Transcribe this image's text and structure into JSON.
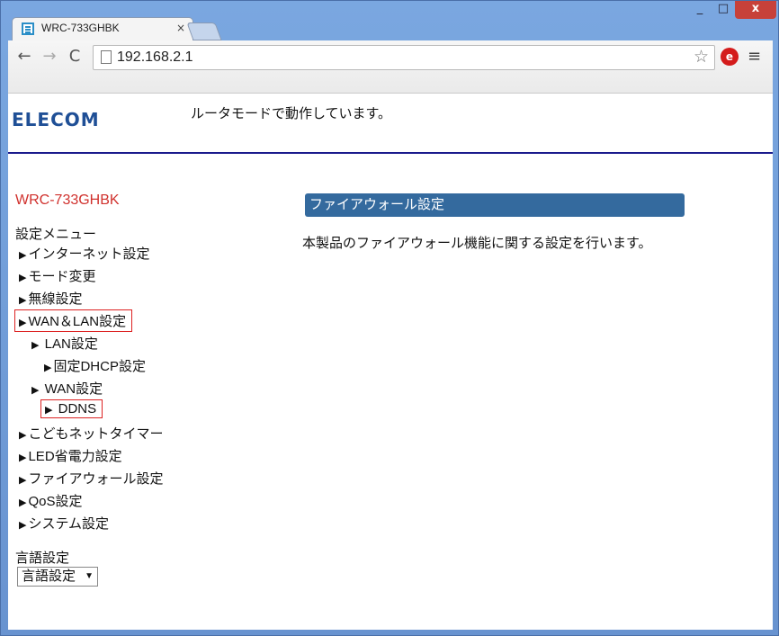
{
  "browser": {
    "tab_title": "WRC-733GHBK",
    "tab_close": "×",
    "url": "192.168.2.1",
    "window_min": "_",
    "window_max": "□",
    "window_close": "x",
    "nav_back": "←",
    "nav_forward": "→",
    "nav_reload": "C",
    "star_icon": "☆",
    "extension_icon": "e",
    "menu_icon": "≡"
  },
  "header": {
    "logo": "ELECOM",
    "mode_status": "ルータモードで動作しています。"
  },
  "sidebar": {
    "device_name": "WRC-733GHBK",
    "menu_heading": "設定メニュー",
    "items": [
      {
        "label": "インターネット設定"
      },
      {
        "label": "モード変更"
      },
      {
        "label": "無線設定"
      },
      {
        "label": "WAN＆LAN設定"
      },
      {
        "label": "LAN設定"
      },
      {
        "label": "固定DHCP設定"
      },
      {
        "label": "WAN設定"
      },
      {
        "label": "DDNS"
      },
      {
        "label": "こどもネットタイマー"
      },
      {
        "label": "LED省電力設定"
      },
      {
        "label": "ファイアウォール設定"
      },
      {
        "label": "QoS設定"
      },
      {
        "label": "システム設定"
      }
    ],
    "language_heading": "言語設定",
    "language_select_value": "言語設定"
  },
  "main": {
    "section_title": "ファイアウォール設定",
    "section_description": "本製品のファイアウォール機能に関する設定を行います。"
  },
  "colors": {
    "section_title_bg": "#346a9e",
    "device_name": "#d0312d",
    "header_rule": "#1a1a8c",
    "highlight_border": "#dd2222"
  }
}
